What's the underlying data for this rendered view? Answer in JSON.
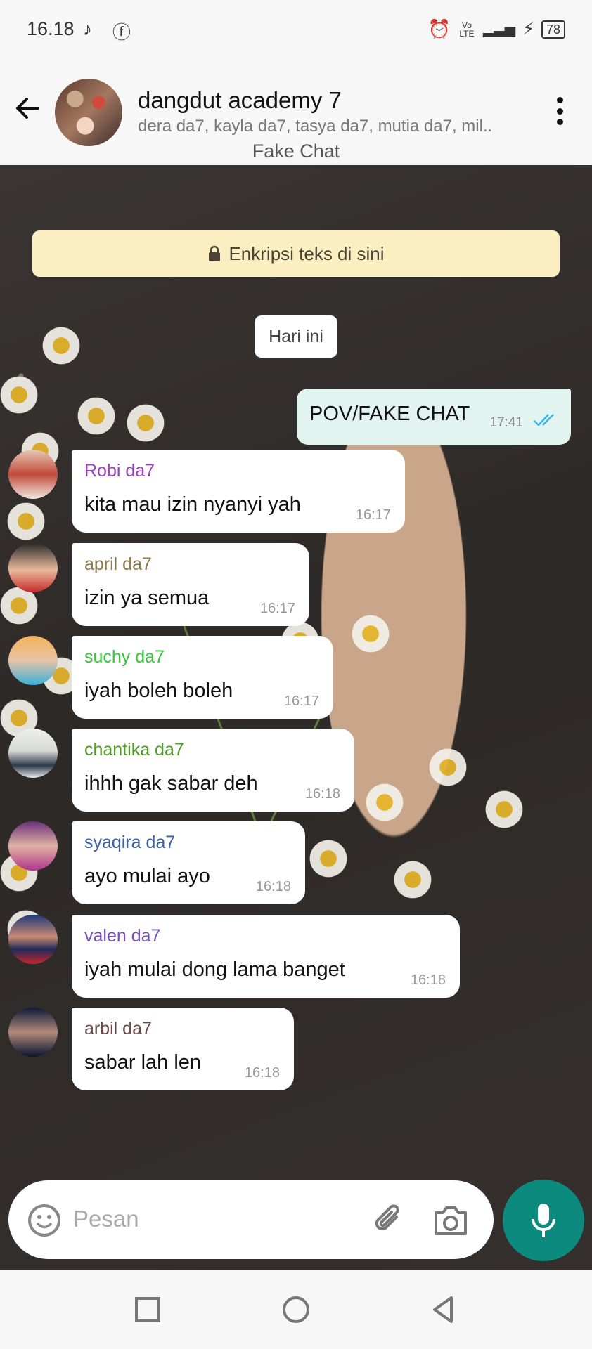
{
  "status": {
    "time": "16.18",
    "battery": "78",
    "network": "Vo LTE"
  },
  "header": {
    "group_name": "dangdut academy 7",
    "members": "dera da7, kayla da7, tasya da7, mutia da7, mil..",
    "subtitle": "Fake Chat"
  },
  "chat": {
    "encryption_notice": "Enkripsi teks di sini",
    "day_label": "Hari ini",
    "outgoing": {
      "text": "POV/FAKE CHAT",
      "time": "17:41"
    },
    "messages": [
      {
        "sender": "Robi da7",
        "text": "kita mau izin nyanyi yah",
        "time": "16:17",
        "color": "#9b3fbf"
      },
      {
        "sender": "april da7",
        "text": "izin ya semua",
        "time": "16:17",
        "color": "#8c7a4b"
      },
      {
        "sender": "suchy da7",
        "text": "iyah boleh boleh",
        "time": "16:17",
        "color": "#35c43a"
      },
      {
        "sender": "chantika da7",
        "text": "ihhh gak sabar deh",
        "time": "16:18",
        "color": "#4f9a22"
      },
      {
        "sender": "syaqira da7",
        "text": "ayo mulai ayo",
        "time": "16:18",
        "color": "#3a5ea8"
      },
      {
        "sender": "valen da7",
        "text": "iyah mulai dong lama banget",
        "time": "16:18",
        "color": "#7a4fb8"
      },
      {
        "sender": "arbil da7",
        "text": "sabar lah len",
        "time": "16:18",
        "color": "#6b4a4a"
      }
    ]
  },
  "input": {
    "placeholder": "Pesan"
  },
  "colors": {
    "accent": "#0b8a7d",
    "outgoing_bubble": "#e2f4f0",
    "encryption_bg": "#fbefc2"
  }
}
